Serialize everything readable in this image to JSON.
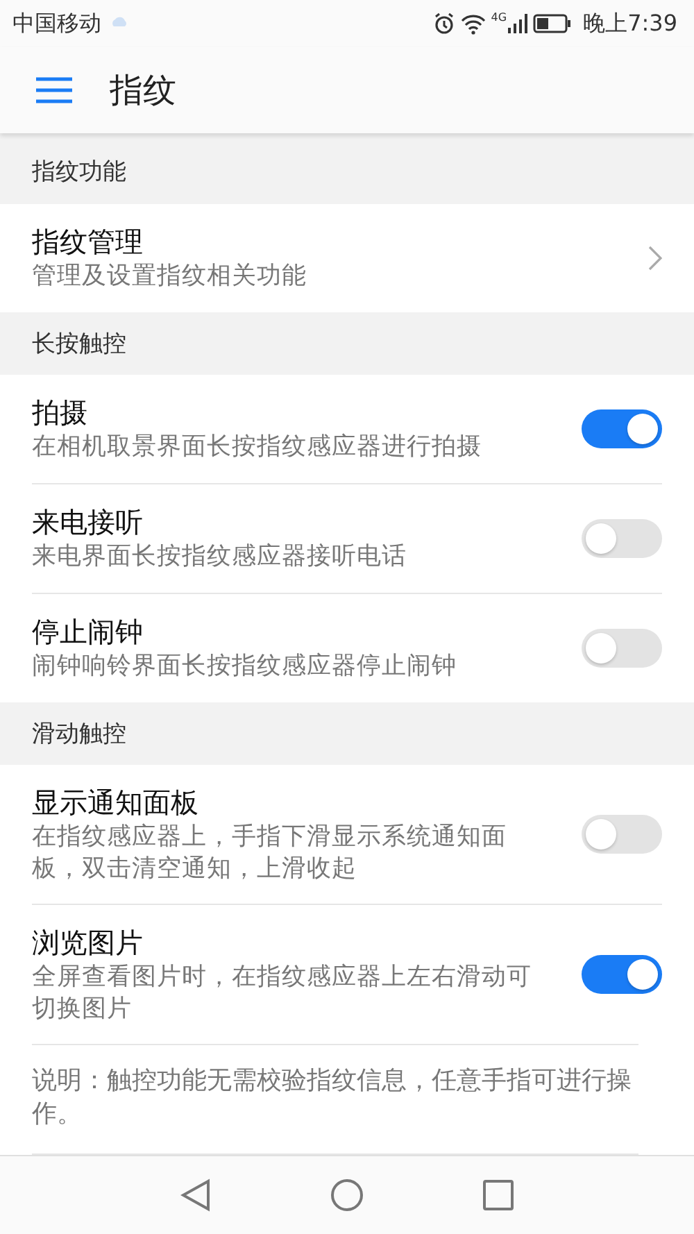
{
  "status_bar": {
    "carrier": "中国移动",
    "network": "4G",
    "time": "晚上7:39"
  },
  "app_bar": {
    "title": "指纹"
  },
  "sections": [
    {
      "header": "指纹功能",
      "items": [
        {
          "kind": "link",
          "title": "指纹管理",
          "subtitle": "管理及设置指纹相关功能"
        }
      ]
    },
    {
      "header": "长按触控",
      "items": [
        {
          "kind": "toggle",
          "title": "拍摄",
          "subtitle": "在相机取景界面长按指纹感应器进行拍摄",
          "on": true
        },
        {
          "kind": "toggle",
          "title": "来电接听",
          "subtitle": "来电界面长按指纹感应器接听电话",
          "on": false
        },
        {
          "kind": "toggle",
          "title": "停止闹钟",
          "subtitle": "闹钟响铃界面长按指纹感应器停止闹钟",
          "on": false
        }
      ]
    },
    {
      "header": "滑动触控",
      "items": [
        {
          "kind": "toggle",
          "title": "显示通知面板",
          "subtitle": "在指纹感应器上，手指下滑显示系统通知面板，双击清空通知，上滑收起",
          "on": false
        },
        {
          "kind": "toggle",
          "title": "浏览图片",
          "subtitle": "全屏查看图片时，在指纹感应器上左右滑动可切换图片",
          "on": true
        }
      ]
    }
  ],
  "note": "说明：触控功能无需校验指纹信息，任意手指可进行操作。"
}
